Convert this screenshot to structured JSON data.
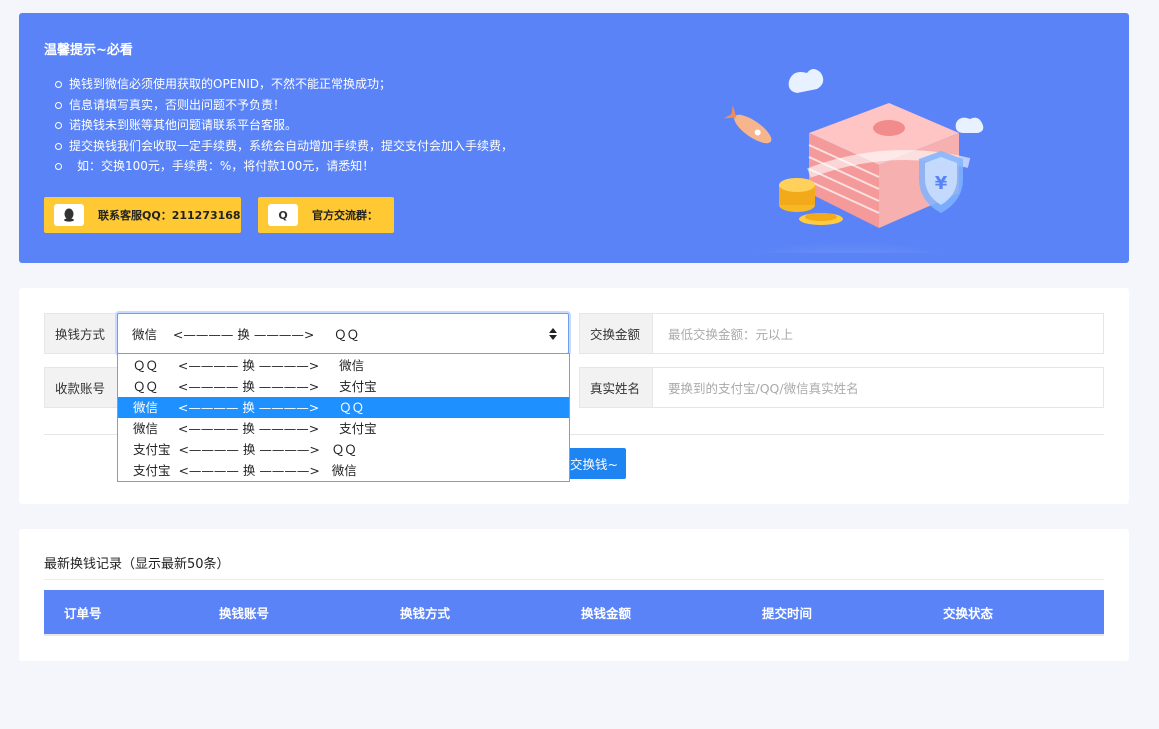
{
  "banner": {
    "title": "温馨提示~必看",
    "tips": [
      "换钱到微信必须使用获取的OPENID，不然不能正常换成功；",
      "信息请填写真实，否则出问题不予负责！",
      "诺换钱未到账等其他问题请联系平台客服。",
      "提交换钱我们会收取一定手续费，系统会自动增加手续费，提交支付会加入手续费，",
      "如：交换100元，手续费：%，将付款100元，请悉知！"
    ],
    "contact_button": {
      "icon": "qq-penguin-icon",
      "label": "联系客服QQ：211273168"
    },
    "group_button": {
      "icon": "q-icon",
      "icon_text": "Q",
      "label": "官方交流群："
    },
    "accent": "#5a83f7",
    "button_color": "#ffc933"
  },
  "form": {
    "method_label": "换钱方式",
    "method_selected": "微信    <———— 换 ————>     ＱＱ",
    "method_options": [
      "ＱＱ     <———— 换 ————>     微信",
      "ＱＱ     <———— 换 ————>     支付宝",
      "微信     <———— 换 ————>     ＱＱ",
      "微信     <———— 换 ————>     支付宝",
      "支付宝  <———— 换 ————>   ＱＱ",
      "支付宝  <———— 换 ————>   微信"
    ],
    "selected_index": 2,
    "amount_label": "交换金额",
    "amount_placeholder": "最低交换金额：元以上",
    "account_label": "收款账号",
    "name_label": "真实姓名",
    "name_placeholder": "要换到的支付宝/QQ/微信真实姓名",
    "submit_label": "交换钱~",
    "submit_color": "#1e84f2"
  },
  "records": {
    "title": "最新换钱记录（显示最新50条）",
    "columns": [
      "订单号",
      "换钱账号",
      "换钱方式",
      "换钱金额",
      "提交时间",
      "交换状态"
    ]
  }
}
